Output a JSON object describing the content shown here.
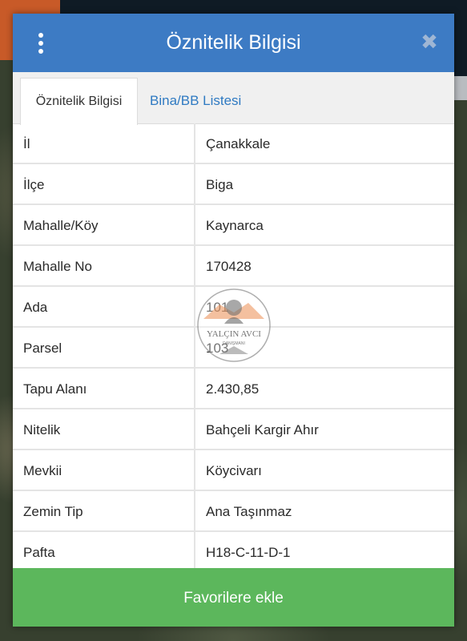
{
  "dialog": {
    "title": "Öznitelik Bilgisi",
    "close_symbol": "✖"
  },
  "tabs": [
    {
      "label": "Öznitelik Bilgisi",
      "active": true
    },
    {
      "label": "Bina/BB Listesi",
      "active": false
    }
  ],
  "rows": [
    {
      "label": "İl",
      "value": "Çanakkale"
    },
    {
      "label": "İlçe",
      "value": "Biga"
    },
    {
      "label": "Mahalle/Köy",
      "value": "Kaynarca"
    },
    {
      "label": "Mahalle No",
      "value": "170428"
    },
    {
      "label": "Ada",
      "value": "101"
    },
    {
      "label": "Parsel",
      "value": "103"
    },
    {
      "label": "Tapu Alanı",
      "value": "2.430,85"
    },
    {
      "label": "Nitelik",
      "value": "Bahçeli Kargir Ahır"
    },
    {
      "label": "Mevkii",
      "value": "Köycivarı"
    },
    {
      "label": "Zemin Tip",
      "value": "Ana Taşınmaz"
    },
    {
      "label": "Pafta",
      "value": "H18-C-11-D-1"
    }
  ],
  "watermark": {
    "name": "YALÇIN AVCI",
    "subtitle": "DANIŞMANI"
  },
  "actions": {
    "favorite_label": "Favorilere ekle"
  },
  "colors": {
    "header": "#3d7bc4",
    "button": "#5cb75c",
    "tab_link": "#2f7ac2"
  }
}
